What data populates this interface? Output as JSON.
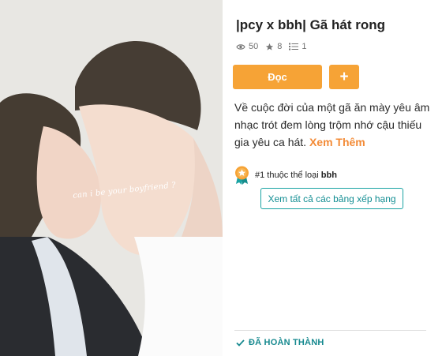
{
  "story": {
    "title": "|pcy x bbh| Gã hát rong",
    "cover_caption": "can i be your boyfriend ?",
    "stats": {
      "reads": "50",
      "votes": "8",
      "parts": "1"
    },
    "read_label": "Đọc",
    "add_label": "+",
    "description": "Về cuộc đời của một gã ăn mày yêu âm nhạc trót đem lòng trộm nhớ cậu thiếu gia yêu ca hát.",
    "see_more_label": "Xem Thêm",
    "rank": {
      "prefix": "#1 thuộc thể loại",
      "tag": "bbh"
    },
    "rank_link_label": "Xem tất cả các bảng xếp hạng",
    "status_label": "ĐÃ HOÀN THÀNH"
  },
  "icons": {
    "reads": "eye-icon",
    "votes": "star-icon",
    "parts": "list-icon",
    "rank": "medal-icon",
    "status": "check-icon"
  },
  "colors": {
    "accent": "#f6a336",
    "see_more": "#f38b37",
    "teal": "#138e93",
    "text": "#222222"
  }
}
